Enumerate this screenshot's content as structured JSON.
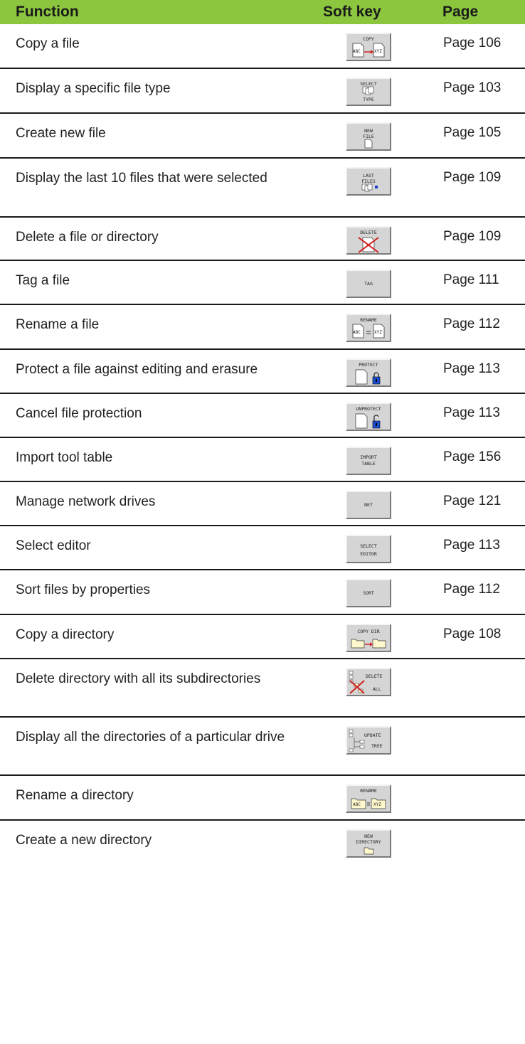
{
  "header": {
    "function": "Function",
    "soft_key": "Soft key",
    "page": "Page"
  },
  "rows": [
    {
      "function": "Copy a file",
      "page": "Page 106",
      "key": {
        "icon": "copy-file-icon",
        "line1": "COPY",
        "left": "ABC",
        "right": "XYZ"
      }
    },
    {
      "function": "Display a specific file type",
      "page": "Page 103",
      "key": {
        "icon": "select-type-icon",
        "line1": "SELECT",
        "line2": "TYPE"
      }
    },
    {
      "function": "Create new file",
      "page": "Page 105",
      "key": {
        "icon": "new-file-icon",
        "line1": "NEW",
        "line2": "FILE"
      }
    },
    {
      "function": "Display the last 10 files that were selected",
      "page": "Page 109",
      "key": {
        "icon": "last-files-icon",
        "line1": "LAST",
        "line2": "FILES"
      }
    },
    {
      "function": "Delete a file or directory",
      "page": "Page 109",
      "key": {
        "icon": "delete-icon",
        "line1": "DELETE"
      }
    },
    {
      "function": "Tag a file",
      "page": "Page 111",
      "key": {
        "icon": "tag-icon",
        "line1": "TAG"
      }
    },
    {
      "function": "Rename a file",
      "page": "Page 112",
      "key": {
        "icon": "rename-file-icon",
        "line1": "RENAME",
        "left": "ABC",
        "right": "XYZ"
      }
    },
    {
      "function": "Protect a file against editing and erasure",
      "page": "Page 113",
      "key": {
        "icon": "lock-icon",
        "line1": "PROTECT"
      }
    },
    {
      "function": "Cancel file protection",
      "page": "Page 113",
      "key": {
        "icon": "unlock-icon",
        "line1": "UNPROTECT"
      }
    },
    {
      "function": "Import tool table",
      "page": "Page 156",
      "key": {
        "icon": "import-table-icon",
        "line1": "IMPORT",
        "line2": "TABLE"
      }
    },
    {
      "function": "Manage network drives",
      "page": "Page 121",
      "key": {
        "icon": "net-icon",
        "line1": "NET"
      }
    },
    {
      "function": "Select editor",
      "page": "Page 113",
      "key": {
        "icon": "select-editor-icon",
        "line1": "SELECT",
        "line2": "EDITOR"
      }
    },
    {
      "function": "Sort files by properties",
      "page": "Page 112",
      "key": {
        "icon": "sort-icon",
        "line1": "SORT"
      }
    },
    {
      "function": "Copy a directory",
      "page": "Page 108",
      "key": {
        "icon": "copy-dir-icon",
        "line1": "COPY DIR"
      }
    },
    {
      "function": "Delete directory with all its subdirectories",
      "page": "",
      "key": {
        "icon": "delete-all-icon",
        "line1": "DELETE",
        "line2": "ALL"
      }
    },
    {
      "function": "Display all the directories of a particular drive",
      "page": "",
      "key": {
        "icon": "update-tree-icon",
        "line1": "UPDATE",
        "line2": "TREE"
      }
    },
    {
      "function": "Rename a directory",
      "page": "",
      "key": {
        "icon": "rename-dir-icon",
        "line1": "RENAME",
        "left": "ABC",
        "right": "XYZ"
      }
    },
    {
      "function": "Create a new directory",
      "page": "",
      "key": {
        "icon": "new-directory-icon",
        "line1": "NEW",
        "line2": "DIRECTORY"
      }
    }
  ]
}
